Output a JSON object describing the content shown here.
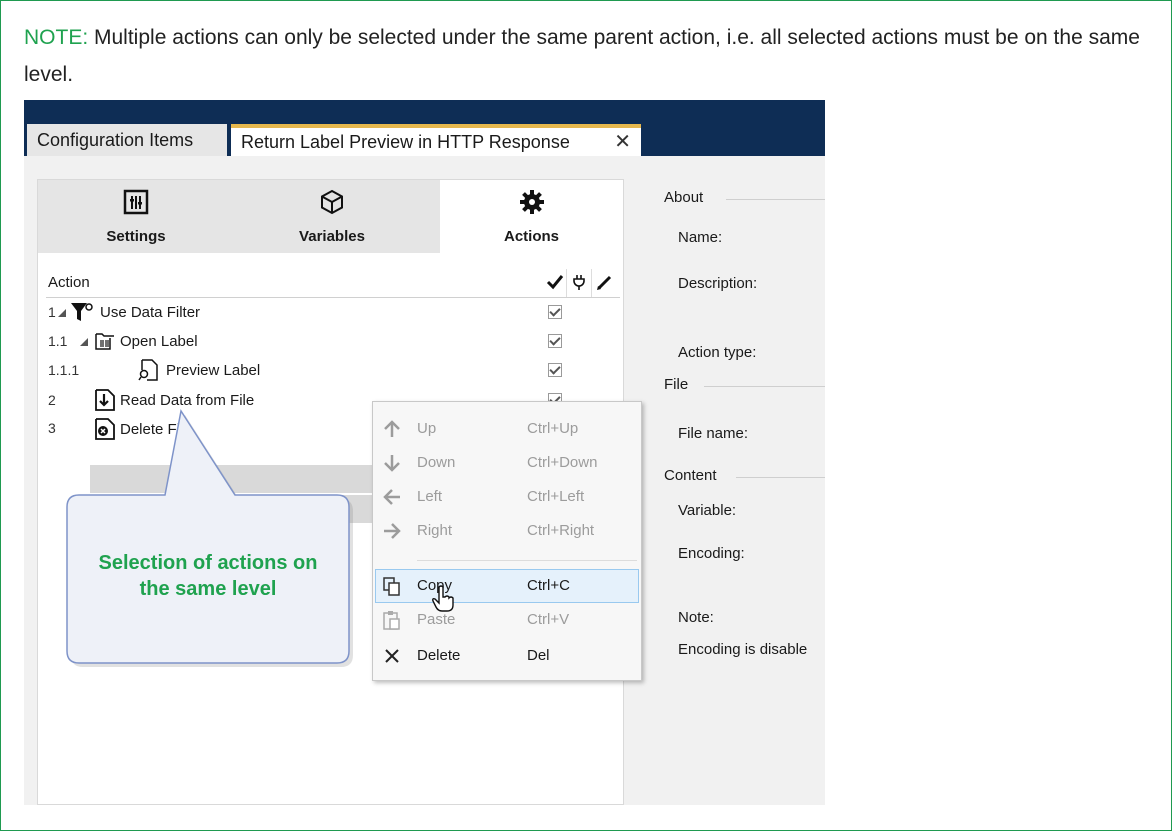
{
  "note": {
    "lead": "NOTE:",
    "text": " Multiple actions can only be selected under the same parent action, i.e. all selected actions must be on the same level."
  },
  "tabs": [
    {
      "label": "Configuration Items"
    },
    {
      "label": "Return Label Preview in HTTP Response",
      "close": "✕"
    }
  ],
  "toolbar": [
    {
      "label": "Settings",
      "icon": "settings-sliders-icon"
    },
    {
      "label": "Variables",
      "icon": "cube-icon"
    },
    {
      "label": "Actions",
      "icon": "gear-icon",
      "active": true
    }
  ],
  "list": {
    "header": "Action",
    "rows": [
      {
        "num": "1",
        "label": "Use Data Filter",
        "icon": "filter-icon",
        "checked": true
      },
      {
        "num": "1.1",
        "label": "Open Label",
        "icon": "open-label-icon",
        "checked": true
      },
      {
        "num": "1.1.1",
        "label": "Preview Label",
        "icon": "preview-label-icon",
        "checked": true
      },
      {
        "num": "2",
        "label": "Read Data from File",
        "icon": "read-data-icon",
        "checked": true,
        "selected": true
      },
      {
        "num": "3",
        "label": "Delete File",
        "icon": "delete-file-icon",
        "selected": true
      }
    ]
  },
  "callout": {
    "text_line1": "Selection of actions on",
    "text_line2": "the same level"
  },
  "context_menu": [
    {
      "label": "Up",
      "shortcut": "Ctrl+Up",
      "icon": "arrow-up-icon",
      "disabled": true
    },
    {
      "label": "Down",
      "shortcut": "Ctrl+Down",
      "icon": "arrow-down-icon",
      "disabled": true
    },
    {
      "label": "Left",
      "shortcut": "Ctrl+Left",
      "icon": "arrow-left-icon",
      "disabled": true
    },
    {
      "label": "Right",
      "shortcut": "Ctrl+Right",
      "icon": "arrow-right-icon",
      "disabled": true
    },
    {
      "label": "Copy",
      "shortcut": "Ctrl+C",
      "icon": "copy-icon",
      "highlighted": true
    },
    {
      "label": "Paste",
      "shortcut": "Ctrl+V",
      "icon": "paste-icon",
      "disabled": true
    },
    {
      "label": "Delete",
      "shortcut": "Del",
      "icon": "delete-x-icon"
    }
  ],
  "properties": {
    "about": "About",
    "name": "Name:",
    "description": "Description:",
    "action_type": "Action type:",
    "file": "File",
    "file_name": "File name:",
    "content": "Content",
    "variable": "Variable:",
    "encoding": "Encoding:",
    "note_label": "Note:",
    "note_text": "Encoding is disable"
  },
  "colors": {
    "accent": "#1fa24f",
    "titlebar": "#0e2d55",
    "tab_active": "#e6b84e",
    "callout_fill": "#eef1f8",
    "callout_border": "#7e93c9"
  }
}
